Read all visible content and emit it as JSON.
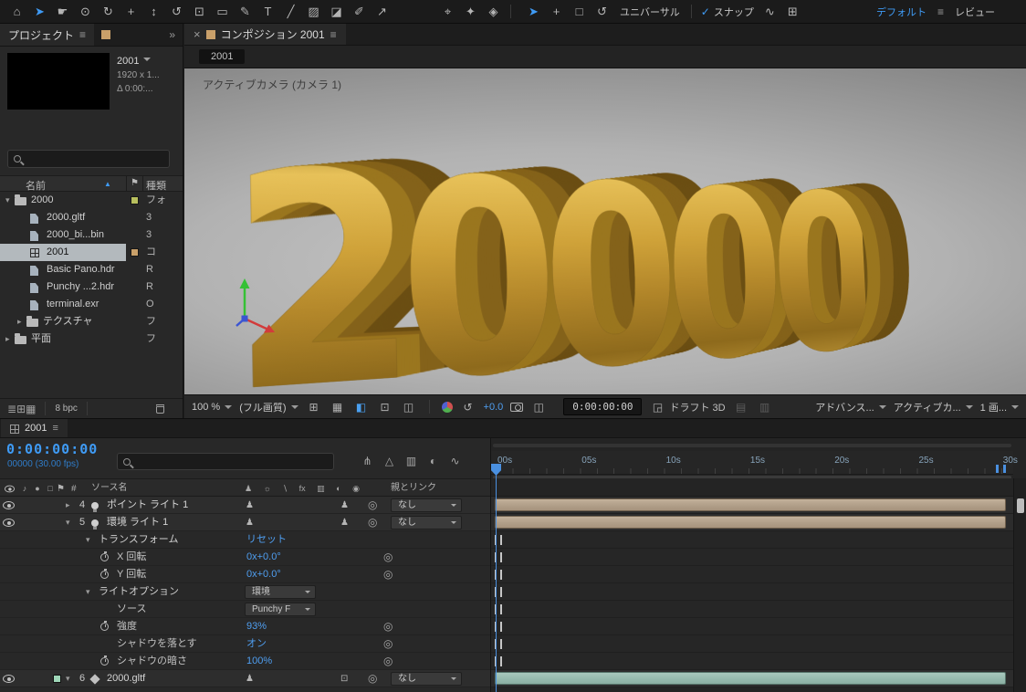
{
  "icons": {
    "menu": "≡",
    "close": "×",
    "chevrons": "»",
    "check": "✓",
    "sort_asc": "▲",
    "flag": "⚑",
    "hash": "#",
    "pickwhip": "◎"
  },
  "toolbar": {
    "tools": [
      {
        "name": "home-icon",
        "glyph": "⌂"
      },
      {
        "name": "selection-tool",
        "glyph": "➤",
        "active": true
      },
      {
        "name": "hand-tool",
        "glyph": "☛"
      },
      {
        "name": "zoom-tool",
        "glyph": "⊙"
      },
      {
        "name": "orbit-camera-tool",
        "glyph": "↻"
      },
      {
        "name": "pan-camera-tool",
        "glyph": "+"
      },
      {
        "name": "dolly-camera-tool",
        "glyph": "↕"
      },
      {
        "name": "rotation-tool",
        "glyph": "↺"
      },
      {
        "name": "pan-behind-tool",
        "glyph": "⊡"
      },
      {
        "name": "shape-tool",
        "glyph": "▭"
      },
      {
        "name": "pen-tool",
        "glyph": "✎"
      },
      {
        "name": "type-tool",
        "glyph": "T"
      },
      {
        "name": "brush-tool",
        "glyph": "╱"
      },
      {
        "name": "clone-stamp-tool",
        "glyph": "▨"
      },
      {
        "name": "eraser-tool",
        "glyph": "◪"
      },
      {
        "name": "roto-brush-tool",
        "glyph": "✐"
      },
      {
        "name": "puppet-pin-tool",
        "glyph": "↗"
      }
    ],
    "gizmo_tools": [
      {
        "name": "axis-mode-local-icon",
        "glyph": "⌖"
      },
      {
        "name": "axis-mode-world-icon",
        "glyph": "✦"
      },
      {
        "name": "axis-mode-view-icon",
        "glyph": "◈"
      }
    ],
    "gizmo2": [
      {
        "name": "selection-gizmo-icon",
        "glyph": "➤",
        "active": true
      },
      {
        "name": "position-gizmo-icon",
        "glyph": "+"
      },
      {
        "name": "scale-gizmo-icon",
        "glyph": "□"
      },
      {
        "name": "rotate-gizmo-icon",
        "glyph": "↺"
      }
    ],
    "universal_label": "ユニバーサル",
    "snap_label": "スナップ",
    "extra": [
      {
        "name": "snap-options-icon",
        "glyph": "∿"
      },
      {
        "name": "grid-options-icon",
        "glyph": "⊞"
      }
    ],
    "workspace_label": "デフォルト",
    "review_label": "レビュー"
  },
  "project": {
    "tab": "プロジェクト",
    "preview": {
      "name": "2001",
      "line2": "1920 x 1...",
      "line3": "Δ 0:00:..."
    },
    "columns": {
      "name": "名前",
      "type": "種類"
    },
    "items": [
      {
        "name": "2000",
        "type": "フォ",
        "icon": "folder",
        "indent": 0,
        "arrow": "▾",
        "chip": "#b8bf5e"
      },
      {
        "name": "2000.gltf",
        "type": "3",
        "icon": "doc",
        "indent": 1
      },
      {
        "name": "2000_bi...bin",
        "type": "3",
        "icon": "doc",
        "indent": 1
      },
      {
        "name": "2001",
        "type": "コ",
        "icon": "comp",
        "indent": 1,
        "selected": true,
        "chip": "#c9a06a"
      },
      {
        "name": "Basic Pano.hdr",
        "type": "R",
        "icon": "doc",
        "indent": 1
      },
      {
        "name": "Punchy ...2.hdr",
        "type": "R",
        "icon": "doc",
        "indent": 1
      },
      {
        "name": "terminal.exr",
        "type": "O",
        "icon": "doc",
        "indent": 1
      },
      {
        "name": "テクスチャ",
        "type": "フ",
        "icon": "folder",
        "indent": 1,
        "arrow": "▸"
      },
      {
        "name": "平面",
        "type": "フ",
        "icon": "folder",
        "indent": 0,
        "arrow": "▸"
      }
    ],
    "footer_icons": [
      {
        "name": "interpret-footage-icon",
        "glyph": "≣"
      },
      {
        "name": "new-folder-icon",
        "glyph": "⊞"
      },
      {
        "name": "new-composition-icon",
        "glyph": "▦"
      }
    ],
    "bpc": "8 bpc"
  },
  "comp": {
    "tab": "コンポジション 2001",
    "breadcrumb": "2001",
    "camera_label": "アクティブカメラ (カメラ 1)",
    "canvas_text": "20000",
    "bar": {
      "zoom": "100 %",
      "quality": "(フル画質)",
      "exposure": "+0.0",
      "timecode": "0:00:00:00",
      "draft": "ドラフト 3D",
      "renderer": "アドバンス...",
      "camera": "アクティブカ...",
      "layout": "1 画..."
    },
    "bar_icons": {
      "grid": "⊞",
      "transparency": "▦",
      "mask": "◧",
      "roi": "⊡",
      "guides": "◫",
      "reset": "↺",
      "show_snapshot": "◫",
      "draft": "◲",
      "fp1": "▤",
      "fp2": "▥"
    }
  },
  "timeline": {
    "tab": "2001",
    "timecode": "0:00:00:00",
    "frames": "00000 (30.00 fps)",
    "ruler": [
      "00s",
      "05s",
      "10s",
      "15s",
      "20s",
      "25s",
      "30s"
    ],
    "columns": {
      "source": "ソース名",
      "parent": "親とリンク"
    },
    "tool_icons": [
      {
        "name": "mini-flowchart-icon",
        "glyph": "⋔"
      },
      {
        "name": "shy-layers-icon",
        "glyph": "△"
      },
      {
        "name": "frame-blend-icon",
        "glyph": "▥"
      },
      {
        "name": "motion-blur-icon",
        "glyph": "◐"
      },
      {
        "name": "graph-editor-icon",
        "glyph": "∿"
      }
    ],
    "av_icons": [
      {
        "name": "eye-icon",
        "glyph": ""
      },
      {
        "name": "audio-icon",
        "glyph": "♪"
      },
      {
        "name": "solo-icon",
        "glyph": "●"
      },
      {
        "name": "lock-icon",
        "glyph": "□"
      }
    ],
    "switch_icons": [
      {
        "name": "shy-switch-icon",
        "glyph": "♟"
      },
      {
        "name": "collapse-switch-icon",
        "glyph": "☼"
      },
      {
        "name": "quality-switch-icon",
        "glyph": "∖"
      },
      {
        "name": "fx-switch-icon",
        "glyph": "fx"
      },
      {
        "name": "frame-blend-switch-icon",
        "glyph": "▥"
      },
      {
        "name": "motion-blur-switch-icon",
        "glyph": "◐"
      },
      {
        "name": "adjustment-switch-icon",
        "glyph": "◉"
      }
    ],
    "rows": [
      {
        "kind": "layer",
        "num": "4",
        "name": "ポイント ライト 1",
        "licon": "light",
        "arrow": "▸",
        "parent": "なし",
        "bar": "tan",
        "eye": true,
        "sw": [
          "♟",
          "♟"
        ]
      },
      {
        "kind": "layer",
        "num": "5",
        "name": "環境 ライト 1",
        "licon": "light",
        "arrow": "▾",
        "parent": "なし",
        "bar": "tan",
        "eye": true,
        "sw": [
          "♟",
          "♟"
        ]
      },
      {
        "kind": "group",
        "label": "トランスフォーム",
        "arrow": "▾",
        "value": "リセット"
      },
      {
        "kind": "prop",
        "label": "X 回転",
        "value": "0x+0.0°",
        "stopwatch": true,
        "pick": true
      },
      {
        "kind": "prop",
        "label": "Y 回転",
        "value": "0x+0.0°",
        "stopwatch": true,
        "pick": true
      },
      {
        "kind": "group",
        "label": "ライトオプション",
        "arrow": "▾",
        "dropdown": "環境"
      },
      {
        "kind": "prop",
        "label": "ソース",
        "dropdown": "Punchy F"
      },
      {
        "kind": "prop",
        "label": "強度",
        "value": "93%",
        "stopwatch": true,
        "pick": true
      },
      {
        "kind": "prop",
        "label": "シャドウを落とす",
        "value": "オン",
        "pick": true
      },
      {
        "kind": "prop",
        "label": "シャドウの暗さ",
        "value": "100%",
        "stopwatch": true,
        "pick": true
      },
      {
        "kind": "layer",
        "num": "6",
        "name": "2000.gltf",
        "licon": "model",
        "arrow": "▾",
        "parent": "なし",
        "bar": "teal",
        "eye": true,
        "chip": "#9fd6b8",
        "sw": [
          "♟",
          "⊡"
        ]
      }
    ]
  }
}
